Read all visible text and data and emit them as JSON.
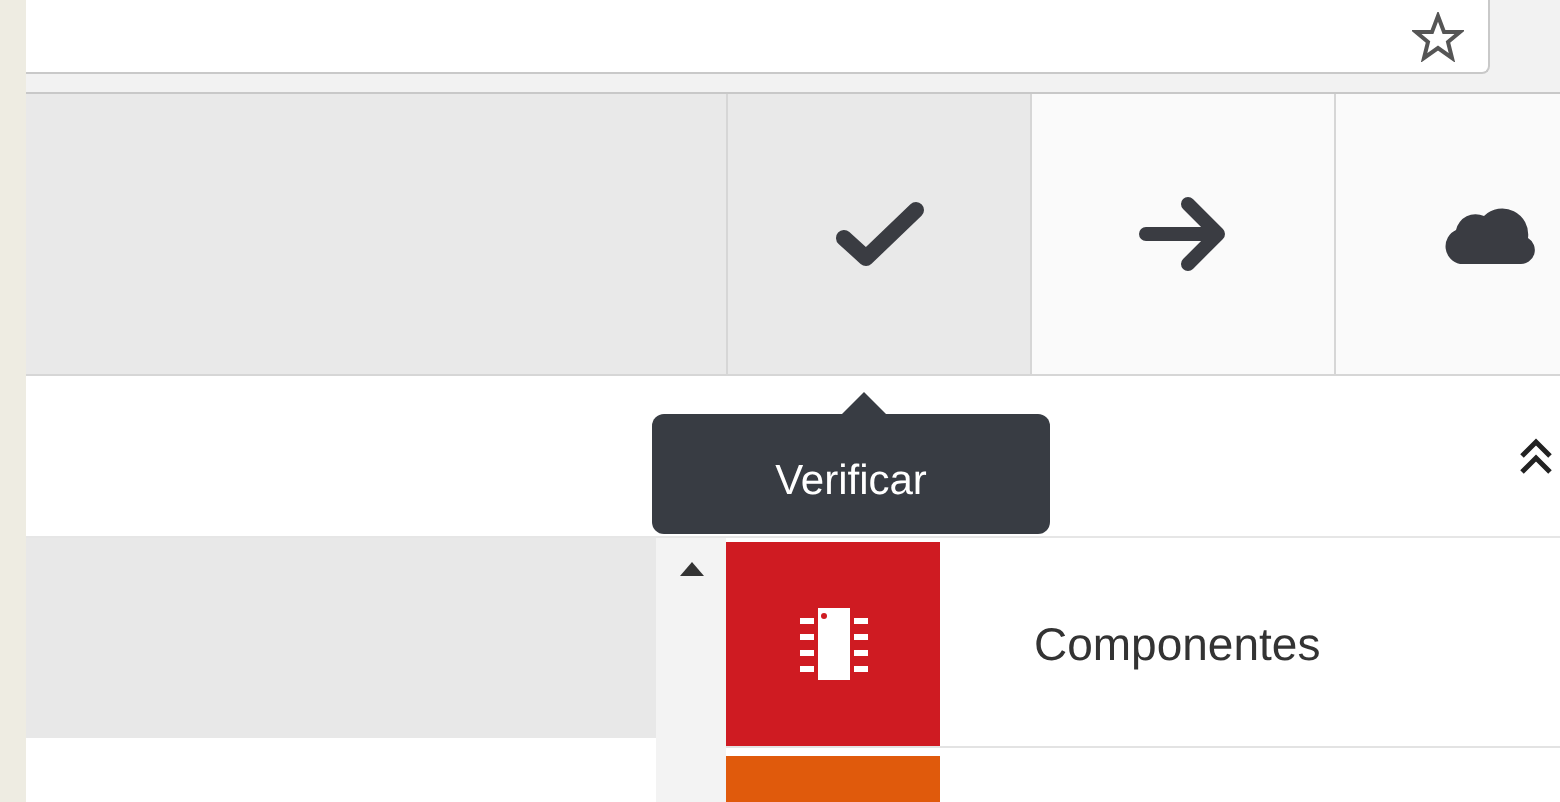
{
  "toolbar": {
    "buttons": [
      {
        "kind": "check",
        "selected": true
      },
      {
        "kind": "arrow",
        "selected": false
      },
      {
        "kind": "cloud",
        "selected": false
      }
    ]
  },
  "tooltip": {
    "text": "Verificar"
  },
  "categories": [
    {
      "label": "Componentes",
      "color": "#cf1b22"
    },
    {
      "color": "#e05a0c"
    }
  ]
}
